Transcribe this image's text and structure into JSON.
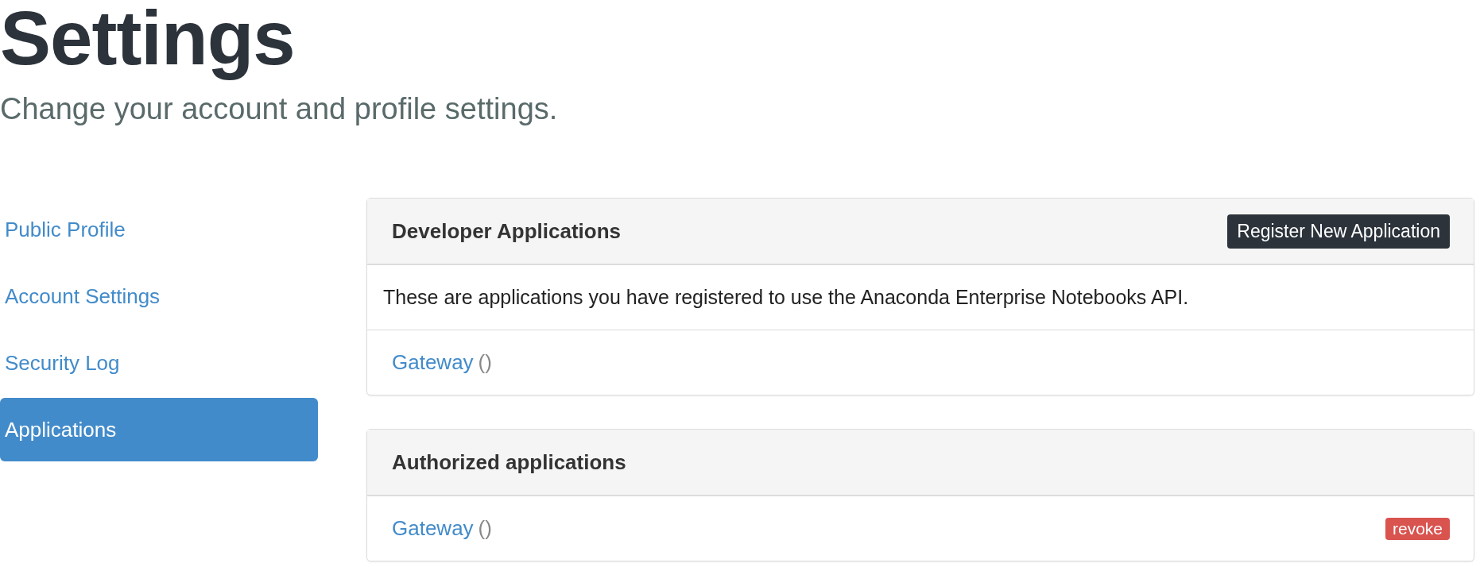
{
  "header": {
    "title": "Settings",
    "subtitle": "Change your account and profile settings."
  },
  "sidebar": {
    "items": [
      {
        "label": "Public Profile",
        "selected": false
      },
      {
        "label": "Account Settings",
        "selected": false
      },
      {
        "label": "Security Log",
        "selected": false
      },
      {
        "label": "Applications",
        "selected": true
      }
    ]
  },
  "panels": [
    {
      "title": "Developer Applications",
      "button": "Register New Application",
      "description": "These are applications you have registered to use the Anaconda Enterprise Notebooks API.",
      "apps": [
        {
          "name": "Gateway",
          "detail": "()"
        }
      ]
    },
    {
      "title": "Authorized applications",
      "apps": [
        {
          "name": "Gateway",
          "detail": "()",
          "action": "revoke"
        }
      ]
    }
  ]
}
